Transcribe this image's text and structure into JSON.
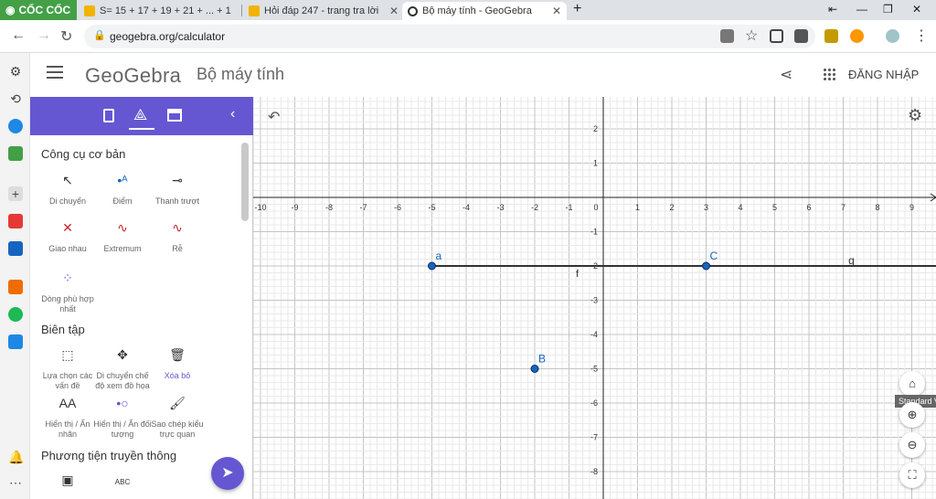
{
  "browser": {
    "brand": "CỐC CỐC",
    "tabs": [
      {
        "title": "S= 15 + 17 + 19 + 21 + ... + 1",
        "icon": "h-icon"
      },
      {
        "title": "Hỏi đáp 247 - trang tra lời",
        "icon": "h-icon"
      },
      {
        "title": "Bộ máy tính - GeoGebra",
        "icon": "geogebra-icon",
        "active": true
      }
    ],
    "url": "geogebra.org/calculator"
  },
  "app": {
    "logo": "GeoGebra",
    "title": "Bộ máy tính",
    "login": "ĐĂNG NHẬP"
  },
  "panel": {
    "sections": [
      {
        "title": "Công cụ cơ bản",
        "tools": [
          "Di chuyển",
          "Điểm",
          "Thanh trượt",
          "Giao nhau",
          "Extremum",
          "Rễ",
          "Dòng phù hợp nhất"
        ]
      },
      {
        "title": "Biên tập",
        "tools": [
          "Lựa chọn các vấn đề",
          "Di chuyển chế độ xem đồ họa",
          "Xóa bỏ",
          "Hiển thị / Ẩn nhãn",
          "Hiển thị / Ẩn đối tượng",
          "Sao chép kiểu trực quan"
        ]
      },
      {
        "title": "Phương tiện truyền thông",
        "tools": [
          "",
          "ABC"
        ]
      }
    ]
  },
  "graph": {
    "x_ticks": [
      "-10",
      "-9",
      "-8",
      "-7",
      "-6",
      "-5",
      "-4",
      "-3",
      "-2",
      "-1",
      "0",
      "1",
      "2",
      "3",
      "4",
      "5",
      "6",
      "7",
      "8",
      "9"
    ],
    "y_ticks": [
      "2",
      "1",
      "-1",
      "-2",
      "-3",
      "-4",
      "-5",
      "-6",
      "-7",
      "-8"
    ],
    "points": [
      {
        "label": "a",
        "x": -5,
        "y": -2
      },
      {
        "label": "C",
        "x": 3,
        "y": -2
      },
      {
        "label": "B",
        "x": -2,
        "y": -5
      }
    ],
    "lines": [
      {
        "label": "g",
        "y": -2
      }
    ],
    "axis_label_f": "f",
    "tooltip": "Standard V",
    "colors": {
      "point": "#1565c0",
      "line": "#333333",
      "accent": "#6557d2"
    }
  }
}
